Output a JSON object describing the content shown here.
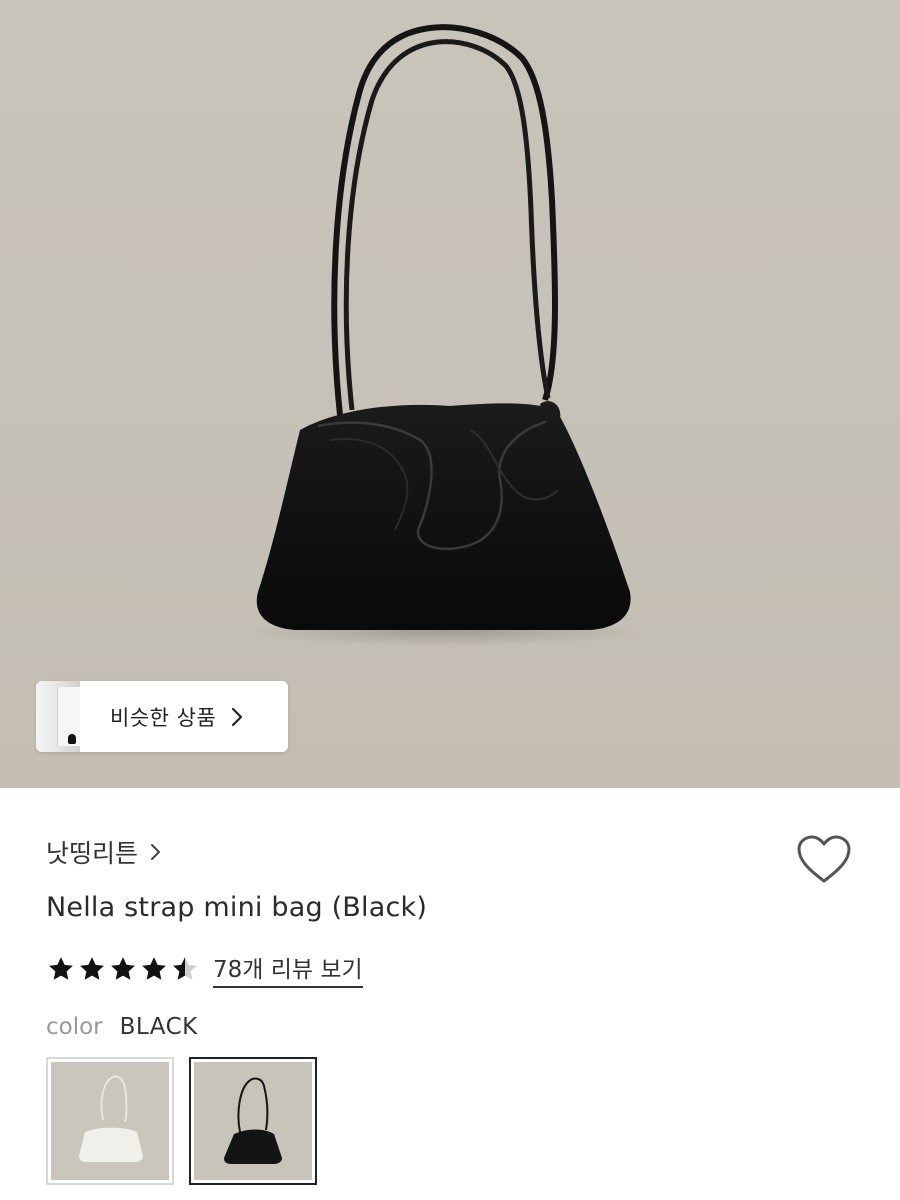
{
  "hero": {
    "image_subject": "black-drawstring-bag-photo",
    "background_color": "#c7c2b7",
    "similar_products": {
      "label": "비슷한 상품",
      "chevron_icon": "chevron-right-icon"
    }
  },
  "product": {
    "brand": "낫띵리튼",
    "brand_chevron_icon": "chevron-right-icon",
    "title": "Nella strap mini bag (Black)",
    "wishlist_icon": "heart-outline-icon",
    "rating": 4.5,
    "rating_max": 5,
    "review_link": "78개 리뷰 보기"
  },
  "options": {
    "color_label": "color",
    "color_value": "BLACK",
    "swatches": [
      {
        "name": "white",
        "selected": false
      },
      {
        "name": "black",
        "selected": true
      }
    ]
  }
}
